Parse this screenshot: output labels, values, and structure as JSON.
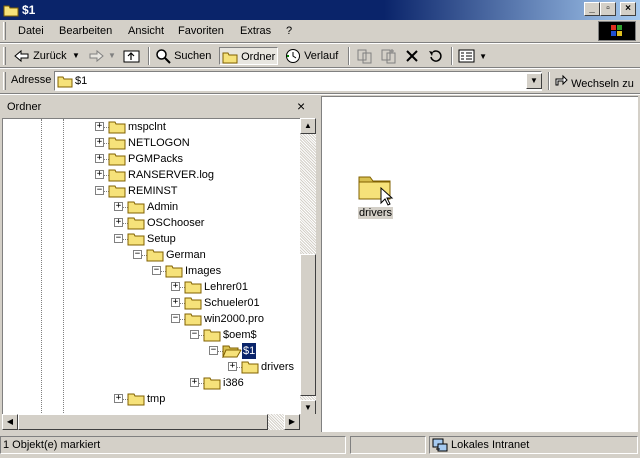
{
  "window": {
    "title": "$1"
  },
  "menu": {
    "items": [
      "Datei",
      "Bearbeiten",
      "Ansicht",
      "Favoriten",
      "Extras",
      "?"
    ]
  },
  "toolbar": {
    "back_label": "Zurück",
    "search_label": "Suchen",
    "folders_label": "Ordner",
    "history_label": "Verlauf"
  },
  "address": {
    "label": "Adresse",
    "value": "$1",
    "go_label": "Wechseln zu"
  },
  "folder_pane": {
    "title": "Ordner",
    "close_glyph": "×",
    "tree": [
      {
        "label": "mspclnt",
        "expander": "+"
      },
      {
        "label": "NETLOGON",
        "expander": "+"
      },
      {
        "label": "PGMPacks",
        "expander": "+"
      },
      {
        "label": "RANSERVER.log",
        "expander": "+"
      },
      {
        "label": "REMINST",
        "expander": "−"
      },
      {
        "label": "Admin",
        "expander": "+"
      },
      {
        "label": "OSChooser",
        "expander": "+"
      },
      {
        "label": "Setup",
        "expander": "−"
      },
      {
        "label": "German",
        "expander": "−"
      },
      {
        "label": "Images",
        "expander": "−"
      },
      {
        "label": "Lehrer01",
        "expander": "+"
      },
      {
        "label": "Schueler01",
        "expander": "+"
      },
      {
        "label": "win2000.pro",
        "expander": "−"
      },
      {
        "label": "$oem$",
        "expander": "−"
      },
      {
        "label": "$1",
        "expander": "−",
        "selected": true
      },
      {
        "label": "drivers",
        "expander": "+"
      },
      {
        "label": "i386",
        "expander": "+"
      },
      {
        "label": "tmp",
        "expander": "+"
      }
    ]
  },
  "content": {
    "items": [
      {
        "label": "drivers",
        "icon": "folder-icon"
      }
    ]
  },
  "status": {
    "selection": "1 Objekt(e) markiert",
    "zone": "Lokales Intranet"
  },
  "colors": {
    "titlebar": "#0a246a",
    "face": "#d4d0c8",
    "folder": "#f6e27a",
    "selection": "#0a246a"
  }
}
